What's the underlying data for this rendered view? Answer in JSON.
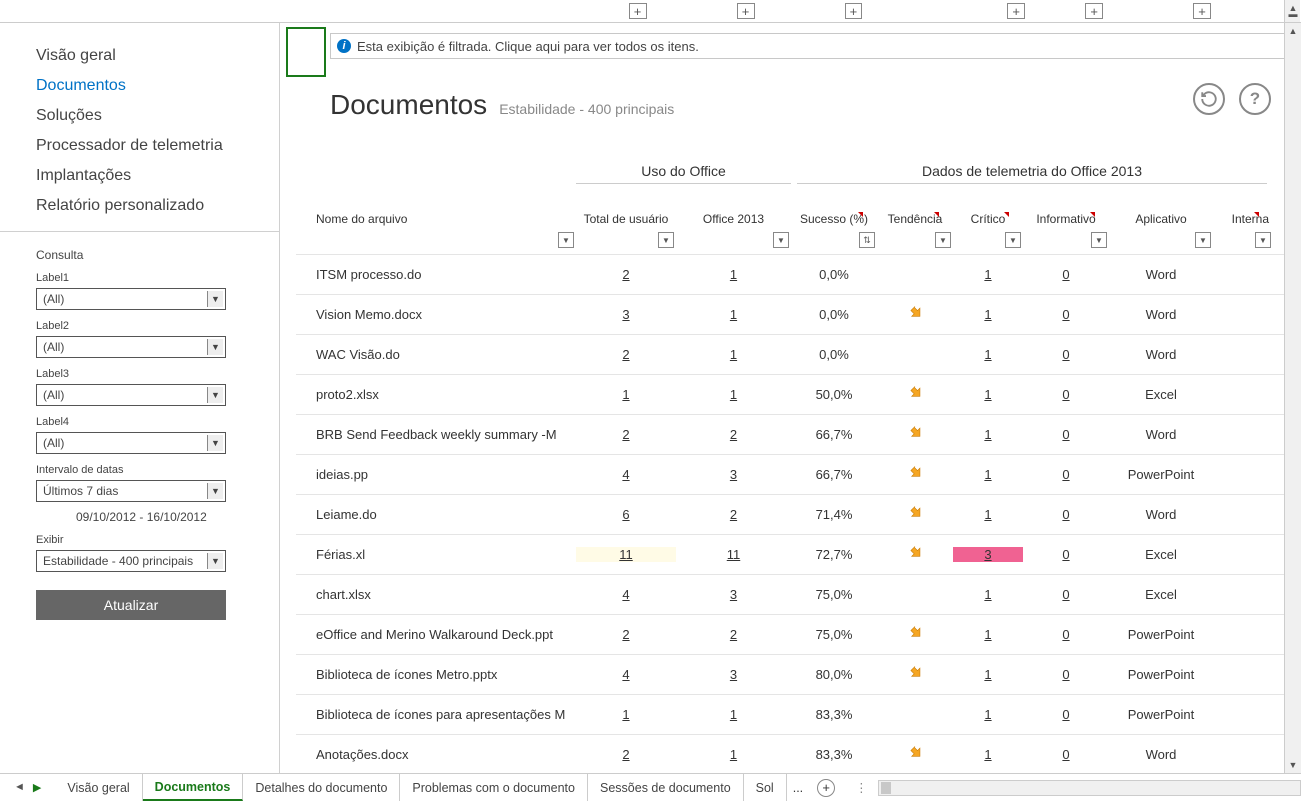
{
  "topbar": {
    "plus": "+"
  },
  "sidebar": {
    "nav": [
      {
        "label": "Visão geral",
        "active": false
      },
      {
        "label": "Documentos",
        "active": true
      },
      {
        "label": "Soluções",
        "active": false
      },
      {
        "label": "Processador de telemetria",
        "active": false
      },
      {
        "label": "Implantações",
        "active": false
      },
      {
        "label": "Relatório personalizado",
        "active": false
      }
    ],
    "filters": {
      "title": "Consulta",
      "label1_caption": "Label1",
      "label1_value": "(All)",
      "label2_caption": "Label2",
      "label2_value": "(All)",
      "label3_caption": "Label3",
      "label3_value": "(All)",
      "label4_caption": "Label4",
      "label4_value": "(All)",
      "daterange_caption": "Intervalo de datas",
      "daterange_value": "Últimos 7 dias",
      "daterange_display": "09/10/2012 - 16/10/2012",
      "show_caption": "Exibir",
      "show_value": "Estabilidade - 400 principais",
      "update_btn": "Atualizar"
    }
  },
  "content": {
    "filter_msg": "Esta exibição é filtrada. Clique aqui para ver todos os itens.",
    "title": "Documentos",
    "subtitle": "Estabilidade - 400 principais",
    "groups": {
      "g1": "Uso do Office",
      "g2": "Dados de telemetria do Office 2013"
    },
    "columns": {
      "name": "Nome do arquivo",
      "total": "Total de usuário",
      "office": "Office 2013",
      "success": "Sucesso (%)",
      "trend": "Tendência",
      "critical": "Crítico",
      "info": "Informativo",
      "app": "Aplicativo",
      "internal": "Interna"
    },
    "rows": [
      {
        "name": "ITSM processo.do",
        "total": "2",
        "office": "1",
        "success": "0,0%",
        "trend": false,
        "critical": "1",
        "info": "0",
        "app": "Word"
      },
      {
        "name": "Vision Memo.docx",
        "total": "3",
        "office": "1",
        "success": "0,0%",
        "trend": true,
        "critical": "1",
        "info": "0",
        "app": "Word"
      },
      {
        "name": "WAC Visão.do",
        "total": "2",
        "office": "1",
        "success": "0,0%",
        "trend": false,
        "critical": "1",
        "info": "0",
        "app": "Word"
      },
      {
        "name": "proto2.xlsx",
        "total": "1",
        "office": "1",
        "success": "50,0%",
        "trend": true,
        "critical": "1",
        "info": "0",
        "app": "Excel"
      },
      {
        "name": "BRB Send Feedback weekly summary -M",
        "total": "2",
        "office": "2",
        "success": "66,7%",
        "trend": true,
        "critical": "1",
        "info": "0",
        "app": "Word"
      },
      {
        "name": "ideias.pp",
        "total": "4",
        "office": "3",
        "success": "66,7%",
        "trend": true,
        "critical": "1",
        "info": "0",
        "app": "PowerPoint"
      },
      {
        "name": "Leiame.do",
        "total": "6",
        "office": "2",
        "success": "71,4%",
        "trend": true,
        "critical": "1",
        "info": "0",
        "app": "Word"
      },
      {
        "name": "Férias.xl",
        "total": "11",
        "office": "11",
        "success": "72,7%",
        "trend": true,
        "critical": "3",
        "info": "0",
        "app": "Excel",
        "critical_hi": true,
        "hl": true
      },
      {
        "name": "chart.xlsx",
        "total": "4",
        "office": "3",
        "success": "75,0%",
        "trend": false,
        "critical": "1",
        "info": "0",
        "app": "Excel"
      },
      {
        "name": "eOffice and Merino Walkaround Deck.ppt",
        "total": "2",
        "office": "2",
        "success": "75,0%",
        "trend": true,
        "critical": "1",
        "info": "0",
        "app": "PowerPoint"
      },
      {
        "name": "Biblioteca de ícones Metro.pptx",
        "total": "4",
        "office": "3",
        "success": "80,0%",
        "trend": true,
        "critical": "1",
        "info": "0",
        "app": "PowerPoint"
      },
      {
        "name": "Biblioteca de ícones para apresentações M",
        "total": "1",
        "office": "1",
        "success": "83,3%",
        "trend": false,
        "critical": "1",
        "info": "0",
        "app": "PowerPoint"
      },
      {
        "name": "Anotações.docx",
        "total": "2",
        "office": "1",
        "success": "83,3%",
        "trend": true,
        "critical": "1",
        "info": "0",
        "app": "Word"
      }
    ]
  },
  "tabs": [
    {
      "label": "Visão geral",
      "active": false
    },
    {
      "label": "Documentos",
      "active": true
    },
    {
      "label": "Detalhes do documento",
      "active": false
    },
    {
      "label": "Problemas com o documento",
      "active": false
    },
    {
      "label": "Sessões de documento",
      "active": false
    },
    {
      "label": "Sol",
      "active": false
    }
  ],
  "tab_more": "..."
}
